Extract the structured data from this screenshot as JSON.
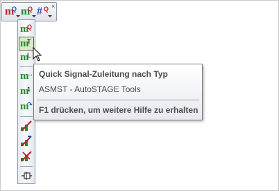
{
  "toolbar_top": {
    "buttons": [
      {
        "name": "m-q-red",
        "letter": "m",
        "sup": "Q",
        "icon": "signal-q-icon"
      },
      {
        "name": "m-q-green",
        "letter": "m",
        "sup": "Q",
        "icon": "signal-q-green-icon"
      },
      {
        "name": "hash-q",
        "letter": "#",
        "sup": "Q",
        "icon": "hash-q-icon"
      }
    ],
    "close_label": "×"
  },
  "toolbar_side": {
    "buttons": [
      {
        "letter": "m",
        "sup": "Q"
      },
      {
        "letter": "m",
        "sup": "T"
      },
      {
        "letter": "m",
        "sup": "L"
      },
      {
        "letter": "m",
        "sup": "→"
      },
      {
        "letter": "m",
        "sup": "1"
      },
      {
        "letter": "m",
        "sup": "↷"
      }
    ]
  },
  "tooltip": {
    "title": "Quick Signal-Zuleitung nach Typ",
    "subtitle": "ASMST - AutoSTAGE Tools",
    "help": "F1 drücken, um weitere Hilfe zu erhalten"
  },
  "colors": {
    "accent_red": "#c0202a",
    "accent_green": "#1e8a2a",
    "accent_blue": "#2c4fb0"
  }
}
